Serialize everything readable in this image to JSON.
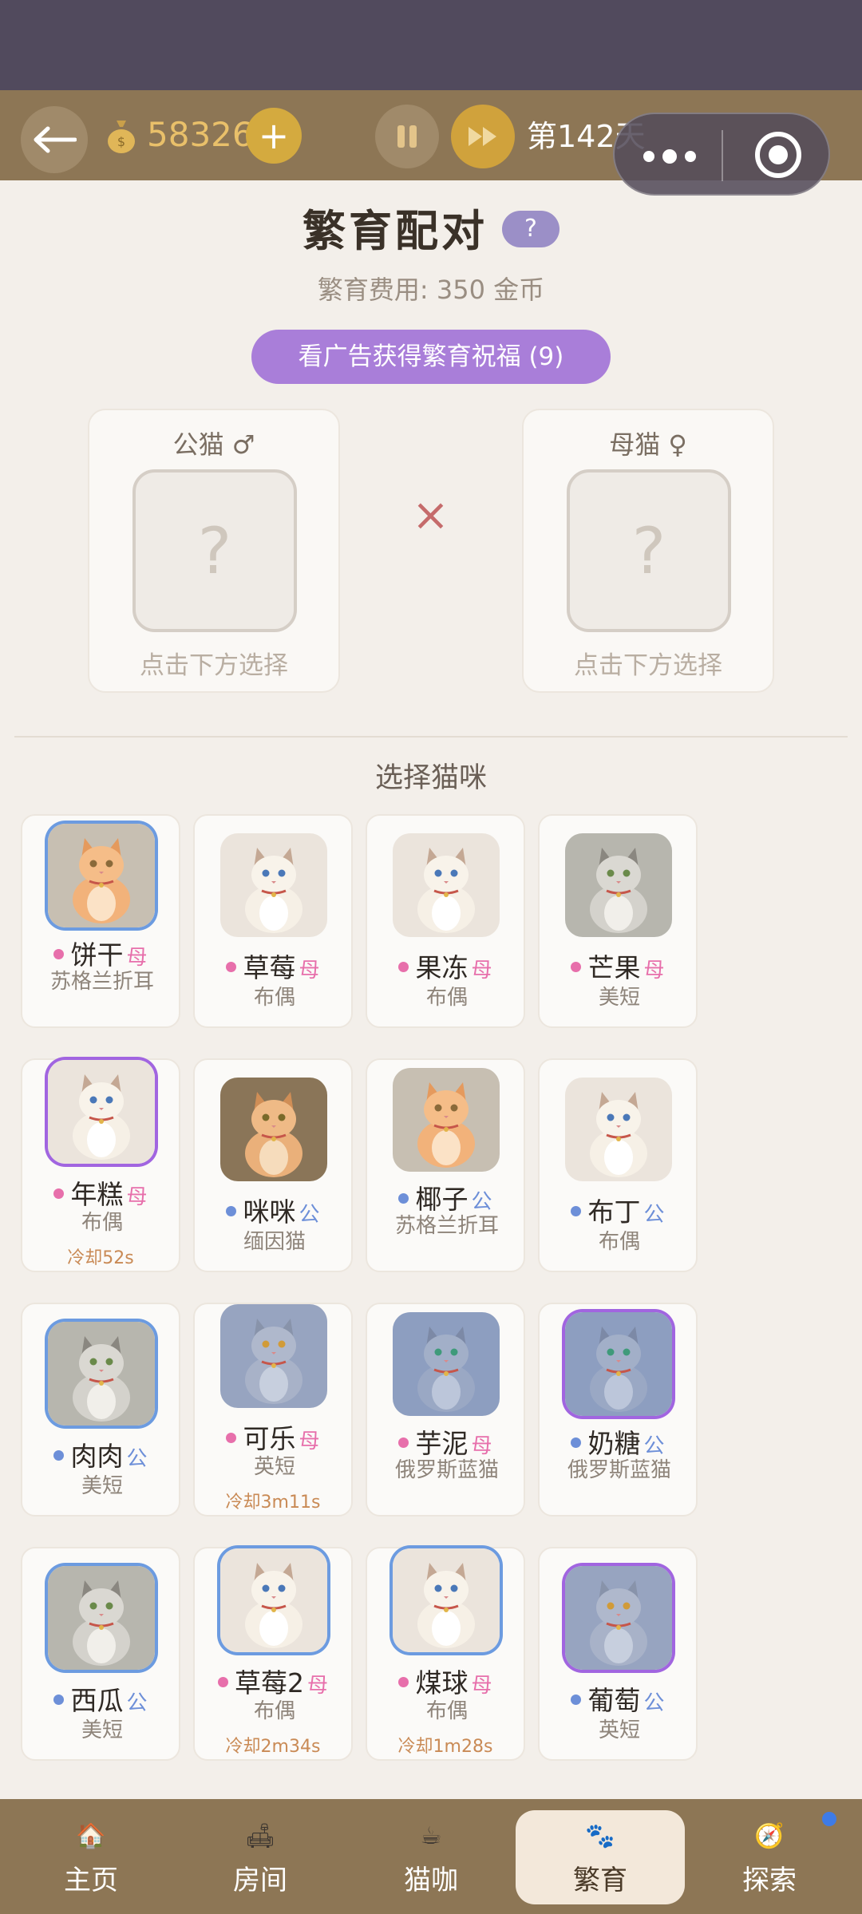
{
  "header": {
    "coins": "58326",
    "day": "第142天"
  },
  "page": {
    "title": "繁育配对",
    "help": "?",
    "fee": "繁育费用: 350 金币",
    "ad_button": "看广告获得繁育祝福 (9)"
  },
  "slots": {
    "male_label": "公猫 ♂",
    "female_label": "母猫 ♀",
    "placeholder": "?",
    "hint": "点击下方选择",
    "cross": "×"
  },
  "select_title": "选择猫咪",
  "cats": [
    {
      "name": "饼干",
      "sex": "母",
      "breed": "苏格兰折耳",
      "cooldown": "",
      "fur": "orange",
      "border": "blue"
    },
    {
      "name": "草莓",
      "sex": "母",
      "breed": "布偶",
      "cooldown": "",
      "fur": "ragdoll",
      "border": "none"
    },
    {
      "name": "果冻",
      "sex": "母",
      "breed": "布偶",
      "cooldown": "",
      "fur": "ragdoll",
      "border": "none"
    },
    {
      "name": "芒果",
      "sex": "母",
      "breed": "美短",
      "cooldown": "",
      "fur": "tabby",
      "border": "none"
    },
    {
      "name": "年糕",
      "sex": "母",
      "breed": "布偶",
      "cooldown": "冷却52s",
      "fur": "ragdoll",
      "border": "purple"
    },
    {
      "name": "咪咪",
      "sex": "公",
      "breed": "缅因猫",
      "cooldown": "",
      "fur": "maine",
      "border": "none"
    },
    {
      "name": "椰子",
      "sex": "公",
      "breed": "苏格兰折耳",
      "cooldown": "",
      "fur": "orange",
      "border": "none"
    },
    {
      "name": "布丁",
      "sex": "公",
      "breed": "布偶",
      "cooldown": "",
      "fur": "ragdoll",
      "border": "none"
    },
    {
      "name": "肉肉",
      "sex": "公",
      "breed": "美短",
      "cooldown": "",
      "fur": "tabby",
      "border": "blue"
    },
    {
      "name": "可乐",
      "sex": "母",
      "breed": "英短",
      "cooldown": "冷却3m11s",
      "fur": "gray",
      "border": "none"
    },
    {
      "name": "芋泥",
      "sex": "母",
      "breed": "俄罗斯蓝猫",
      "cooldown": "",
      "fur": "blue",
      "border": "none"
    },
    {
      "name": "奶糖",
      "sex": "公",
      "breed": "俄罗斯蓝猫",
      "cooldown": "",
      "fur": "blue",
      "border": "purple"
    },
    {
      "name": "西瓜",
      "sex": "公",
      "breed": "美短",
      "cooldown": "",
      "fur": "tabby",
      "border": "blue"
    },
    {
      "name": "草莓2",
      "sex": "母",
      "breed": "布偶",
      "cooldown": "冷却2m34s",
      "fur": "ragdoll",
      "border": "blue"
    },
    {
      "name": "煤球",
      "sex": "母",
      "breed": "布偶",
      "cooldown": "冷却1m28s",
      "fur": "ragdoll",
      "border": "blue"
    },
    {
      "name": "葡萄",
      "sex": "公",
      "breed": "英短",
      "cooldown": "",
      "fur": "gray",
      "border": "purple"
    }
  ],
  "tabs": [
    {
      "label": "主页",
      "icon": "home-icon",
      "active": false
    },
    {
      "label": "房间",
      "icon": "room-icon",
      "active": false
    },
    {
      "label": "猫咖",
      "icon": "cafe-icon",
      "active": false
    },
    {
      "label": "繁育",
      "icon": "breed-icon",
      "active": true
    },
    {
      "label": "探索",
      "icon": "explore-icon",
      "active": false
    }
  ],
  "colors": {
    "top_bar": "#8d7655",
    "accent_purple": "#a97ed9",
    "female": "#e76fab",
    "male": "#6d8fd8"
  }
}
